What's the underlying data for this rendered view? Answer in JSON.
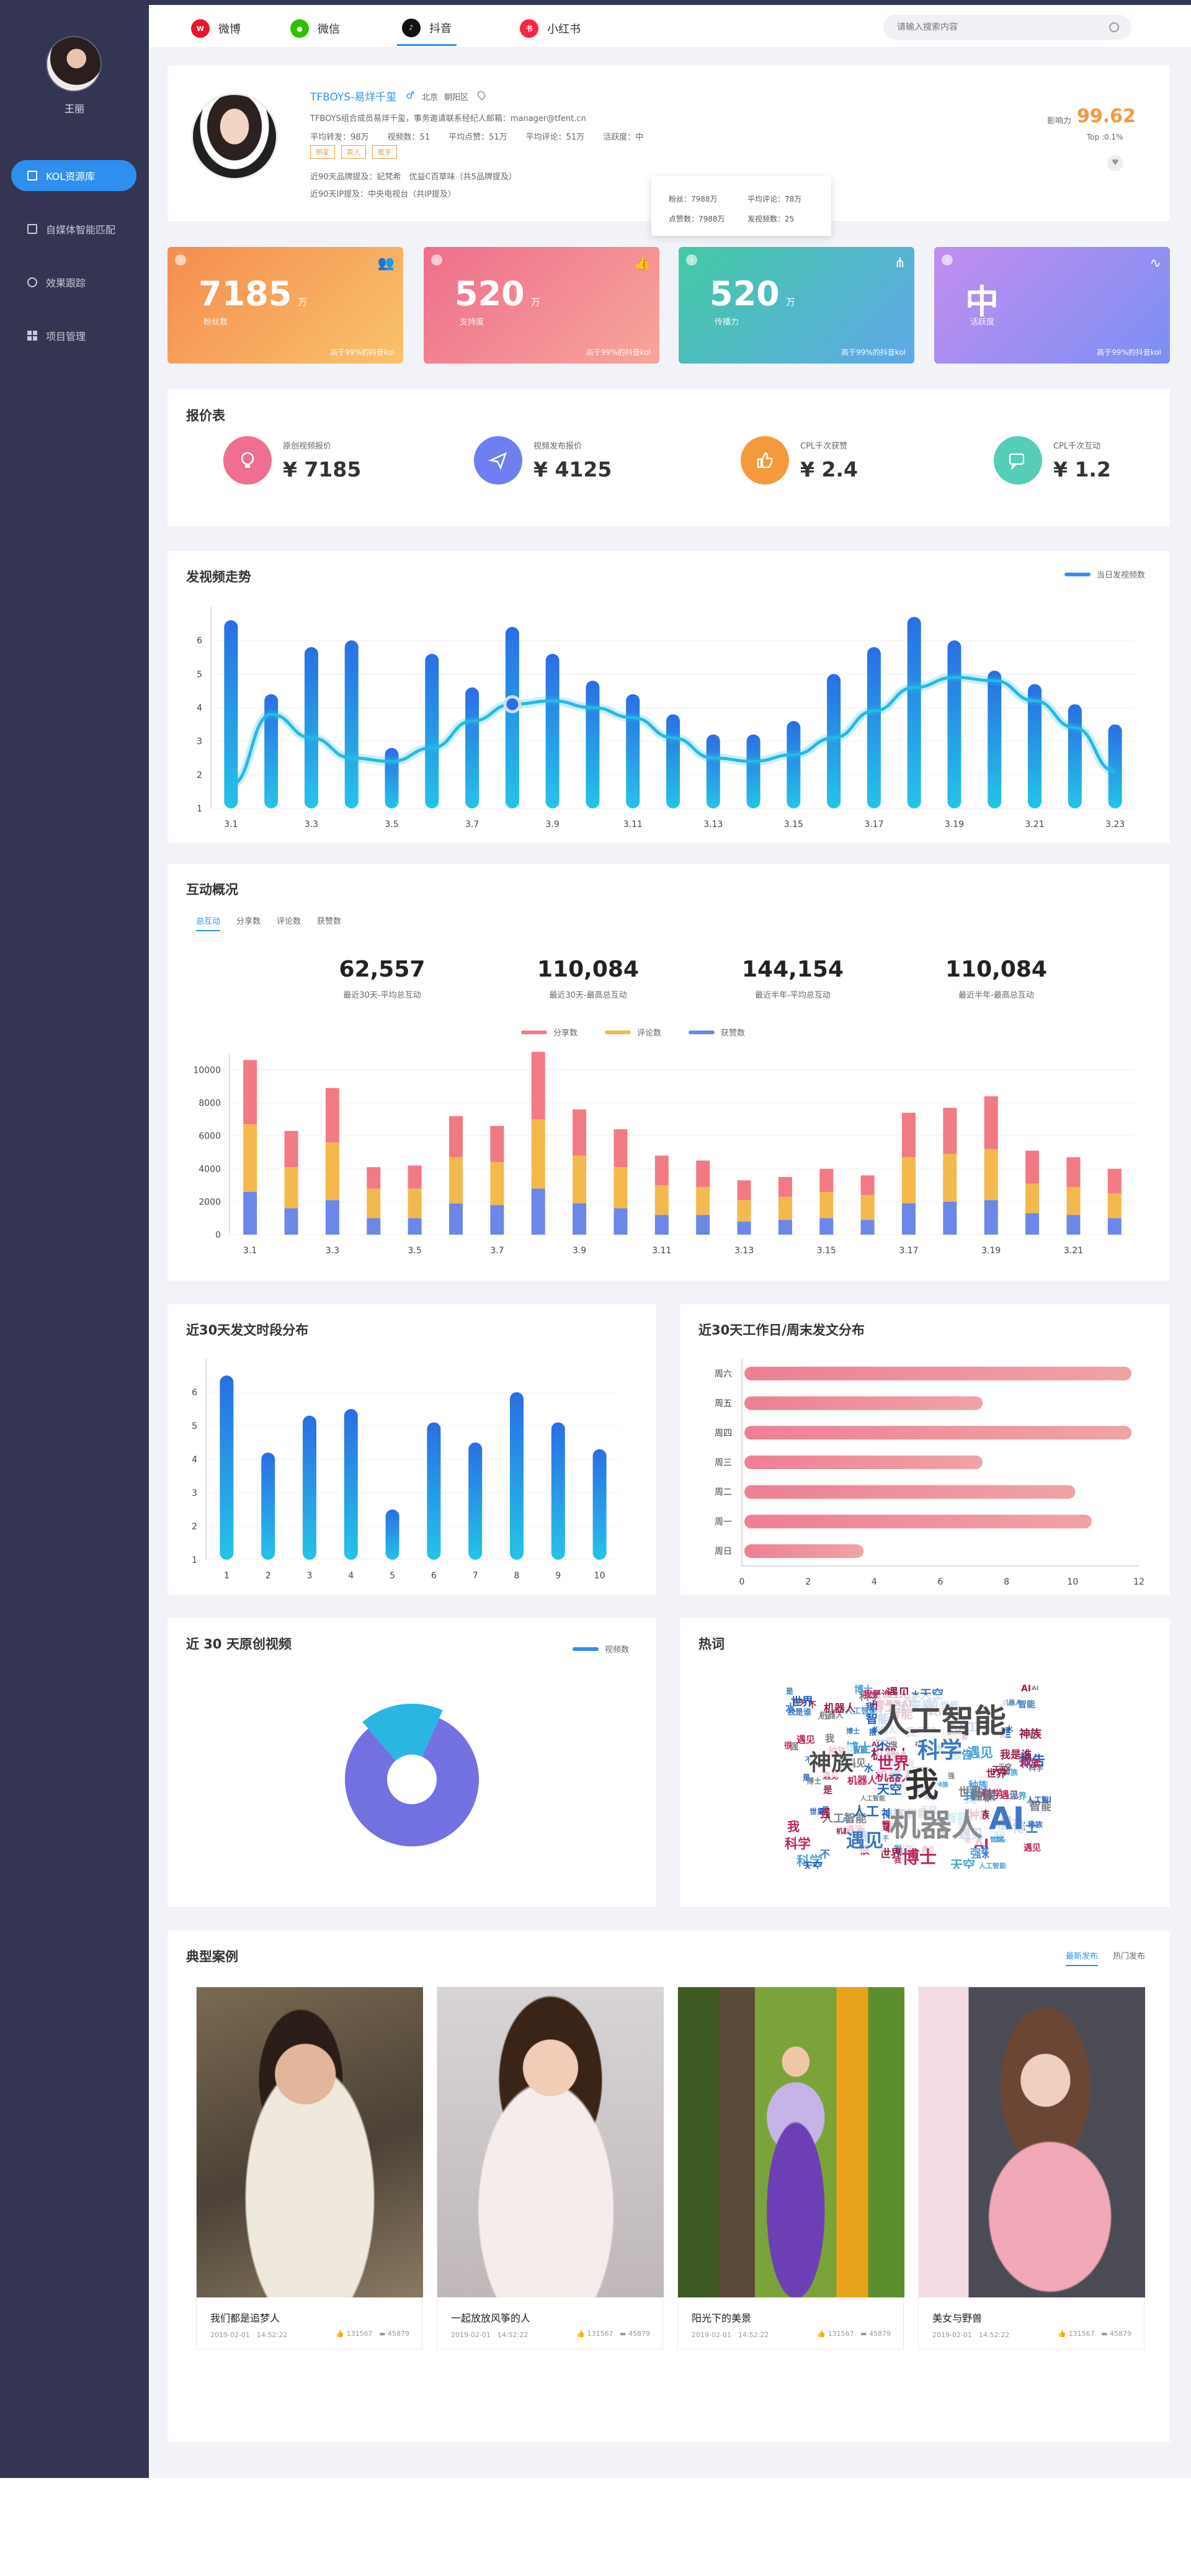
{
  "sidebar": {
    "user_name": "王丽",
    "items": [
      {
        "label": "KOL资源库",
        "icon": "database-icon"
      },
      {
        "label": "自媒体智能匹配",
        "icon": "document-icon"
      },
      {
        "label": "效果跟踪",
        "icon": "target-icon"
      },
      {
        "label": "项目管理",
        "icon": "grid-icon"
      }
    ]
  },
  "header": {
    "tabs": [
      {
        "label": "微博",
        "icon": "weibo-icon",
        "color": "#e6162d"
      },
      {
        "label": "微信",
        "icon": "wechat-icon",
        "color": "#2dc100"
      },
      {
        "label": "抖音",
        "icon": "douyin-icon",
        "color": "#111111"
      },
      {
        "label": "小红书",
        "icon": "xiaohongshu-icon",
        "color": "#ff2442"
      }
    ],
    "search_placeholder": "请输入搜索内容"
  },
  "profile": {
    "name": "TFBOYS-易烊千玺",
    "city": "北京",
    "district": "朝阳区",
    "desc": "TFBOYS组合成员易烊千玺，事务邀请联系经纪人邮箱：manager@tfent.cn",
    "metrics": [
      "平均转发：98万",
      "视频数：51",
      "平均点赞：51万",
      "平均评论：51万",
      "活跃度：中"
    ],
    "tags": [
      "明星",
      "真人",
      "歌手"
    ],
    "line1": "近90天品牌提及：妃梵希　优益C百草味（共5品牌提及）",
    "line2": "近90天IP提及：中央电视台（共IP提及）",
    "influence_label": "影响力",
    "influence_value": "99.62",
    "top": "Top :0.1%",
    "tooltip": [
      "粉丝：7988万",
      "平均评论：78万",
      "点赞数：7988万",
      "发视频数：25"
    ]
  },
  "stats": [
    {
      "value": "7185",
      "unit": "万",
      "label": "粉丝数",
      "note": "高于99%的抖音kol",
      "icon": "users-icon"
    },
    {
      "value": "520",
      "unit": "万",
      "label": "支持度",
      "note": "高于99%的抖音kol",
      "icon": "thumbs-up-icon"
    },
    {
      "value": "520",
      "unit": "万",
      "label": "传播力",
      "note": "高于99%的抖音kol",
      "icon": "share-icon"
    },
    {
      "value": "中",
      "unit": "",
      "label": "活跃度",
      "note": "高于99%的抖音kol",
      "icon": "pulse-icon"
    }
  ],
  "price_table": {
    "title": "报价表",
    "items": [
      {
        "label": "原创视频报价",
        "value": "¥ 7185",
        "icon": "bulb-icon",
        "color": "#ee6f8f"
      },
      {
        "label": "视频发布报价",
        "value": "¥ 4125",
        "icon": "send-icon",
        "color": "#6f7ff0"
      },
      {
        "label": "CPL千次获赞",
        "value": "¥ 2.4",
        "icon": "thumbs-up-icon",
        "color": "#f39a3d"
      },
      {
        "label": "CPL千次互动",
        "value": "¥ 1.2",
        "icon": "chat-icon",
        "color": "#55cdb7"
      }
    ]
  },
  "trend": {
    "title": "发视频走势",
    "legend": "当日发视频数"
  },
  "interaction": {
    "title": "互动概况",
    "tabs": [
      "总互动",
      "分享数",
      "评论数",
      "获赞数"
    ],
    "kpis": [
      {
        "value": "62,557",
        "label": "最近30天-平均总互动"
      },
      {
        "value": "110,084",
        "label": "最近30天-最高总互动"
      },
      {
        "value": "144,154",
        "label": "最近半年-平均总互动"
      },
      {
        "value": "110,084",
        "label": "最近半年-最高总互动"
      }
    ]
  },
  "time_dist": {
    "title": "近30天发文时段分布"
  },
  "week_dist": {
    "title": "近30天工作日/周末发文分布"
  },
  "original": {
    "title": "近 30 天原创视频",
    "legend": "视频数"
  },
  "hotwords": {
    "title": "热词",
    "words": [
      "人工智能",
      "机器人",
      "我",
      "科学",
      "神族",
      "AI",
      "世界",
      "博士",
      "天空",
      "遇见",
      "智能",
      "强",
      "不",
      "是",
      "我是谁",
      "人工",
      "种族",
      "报告",
      "很",
      "水"
    ]
  },
  "cases": {
    "title": "典型案例",
    "tabs": [
      "最新发布",
      "热门发布"
    ],
    "items": [
      {
        "title": "我们都是追梦人",
        "date": "2019-02-01　14:52:22",
        "likes": "131567",
        "comments": "45879"
      },
      {
        "title": "一起放放风筝的人",
        "date": "2019-02-01　14:52:22",
        "likes": "131567",
        "comments": "45879"
      },
      {
        "title": "阳光下的美景",
        "date": "2019-02-01　14:52:22",
        "likes": "131567",
        "comments": "45879"
      },
      {
        "title": "美女与野兽",
        "date": "2019-02-01　14:52:22",
        "likes": "131567",
        "comments": "45879"
      }
    ]
  },
  "chart_data": [
    {
      "type": "bar",
      "title": "发视频走势",
      "categories": [
        "3.1",
        "3.2",
        "3.3",
        "3.4",
        "3.5",
        "3.6",
        "3.7",
        "3.8",
        "3.9",
        "3.10",
        "3.11",
        "3.12",
        "3.13",
        "3.14",
        "3.15",
        "3.16",
        "3.17",
        "3.18",
        "3.19",
        "3.20",
        "3.21",
        "3.22",
        "3.23"
      ],
      "tick_labels": [
        "3.1",
        "3.3",
        "3.5",
        "3.7",
        "3.9",
        "3.11",
        "3.13",
        "3.15",
        "3.17",
        "3.19",
        "3.21",
        "3.23"
      ],
      "values": [
        6.6,
        4.4,
        5.8,
        6,
        2.8,
        5.6,
        4.6,
        6.4,
        5.6,
        4.8,
        4.4,
        3.8,
        3.2,
        3.2,
        3.6,
        5,
        5.8,
        6.7,
        6,
        5.1,
        4.7,
        4.1,
        3.5
      ],
      "smooth_line": [
        1.7,
        3.8,
        3.1,
        2.5,
        2.4,
        2.8,
        3.6,
        4.1,
        4.2,
        4,
        3.7,
        3.1,
        2.5,
        2.4,
        2.6,
        3.1,
        3.9,
        4.6,
        4.9,
        4.8,
        4.2,
        3.4,
        2.1
      ],
      "yticks": [
        1,
        2,
        3,
        4,
        5,
        6
      ],
      "ylim": [
        1,
        7
      ]
    },
    {
      "type": "bar",
      "title": "互动概况",
      "stacked": true,
      "categories": [
        "3.1",
        "3.2",
        "3.3",
        "3.4",
        "3.5",
        "3.6",
        "3.7",
        "3.8",
        "3.9",
        "3.10",
        "3.11",
        "3.12",
        "3.13",
        "3.14",
        "3.15",
        "3.16",
        "3.17",
        "3.18",
        "3.19",
        "3.20",
        "3.21",
        "3.22"
      ],
      "tick_labels": [
        "3.1",
        "3.3",
        "3.5",
        "3.7",
        "3.9",
        "3.11",
        "3.13",
        "3.15",
        "3.17",
        "3.19",
        "3.21"
      ],
      "series": [
        {
          "name": "获赞数",
          "color": "#6d87e8",
          "values": [
            2600,
            1600,
            2100,
            1000,
            1000,
            1900,
            1800,
            2800,
            1900,
            1600,
            1200,
            1200,
            800,
            900,
            1000,
            900,
            1900,
            2000,
            2100,
            1300,
            1200,
            1000
          ]
        },
        {
          "name": "评论数",
          "color": "#f3b94c",
          "values": [
            4100,
            2500,
            3500,
            1800,
            1800,
            2800,
            2600,
            4200,
            2900,
            2500,
            1800,
            1700,
            1300,
            1400,
            1600,
            1500,
            2800,
            2900,
            3100,
            1800,
            1700,
            1500
          ]
        },
        {
          "name": "分享数",
          "color": "#f27a85",
          "values": [
            3900,
            2200,
            3300,
            1300,
            1400,
            2500,
            2200,
            4100,
            2800,
            2300,
            1800,
            1600,
            1200,
            1200,
            1400,
            1200,
            2700,
            2800,
            3200,
            2000,
            1800,
            1500
          ]
        }
      ],
      "yticks": [
        0,
        2000,
        4000,
        6000,
        8000,
        10000
      ],
      "ylim": [
        0,
        11000
      ]
    },
    {
      "type": "bar",
      "title": "近30天发文时段分布",
      "categories": [
        "1",
        "2",
        "3",
        "4",
        "5",
        "6",
        "7",
        "8",
        "9",
        "10"
      ],
      "values": [
        6.5,
        4.2,
        5.3,
        5.5,
        2.5,
        5.1,
        4.5,
        6,
        5.1,
        4.3
      ],
      "yticks": [
        1,
        2,
        3,
        4,
        5,
        6
      ],
      "ylim": [
        1,
        7
      ]
    },
    {
      "type": "bar",
      "title": "近30天工作日/周末发文分布",
      "orientation": "horizontal",
      "categories": [
        "周六",
        "周五",
        "周四",
        "周三",
        "周二",
        "周一",
        "周日"
      ],
      "values": [
        11.7,
        7.2,
        11.7,
        7.2,
        10,
        10.5,
        3.6
      ],
      "xticks": [
        0,
        2,
        4,
        6,
        8,
        10,
        12
      ],
      "xlim": [
        0,
        12
      ]
    },
    {
      "type": "pie",
      "title": "近 30 天原创视频",
      "slices": [
        {
          "name": "slice-1",
          "value": 82,
          "color": "#7371e2"
        },
        {
          "name": "slice-2",
          "value": 18,
          "color": "#2ab6e0"
        }
      ]
    }
  ]
}
